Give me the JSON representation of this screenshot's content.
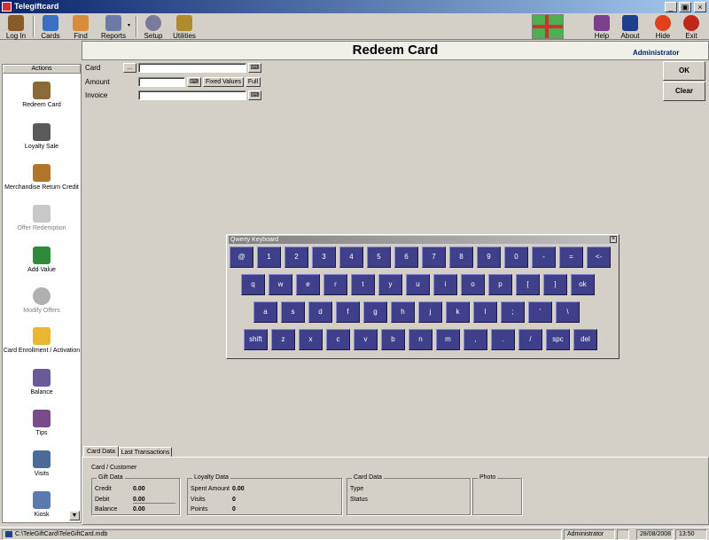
{
  "app": {
    "title": "Telegiftcard"
  },
  "window_buttons": {
    "minimize": "_",
    "restore": "▣",
    "close": "×"
  },
  "toolbar": {
    "login": "Log In",
    "cards": "Cards",
    "find": "Find",
    "reports": "Reports",
    "setup": "Setup",
    "utilities": "Utilities",
    "help": "Help",
    "about": "About",
    "hide": "Hide",
    "exit": "Exit"
  },
  "header": {
    "title": "Redeem Card",
    "user": "Administrator"
  },
  "sidebar": {
    "title": "Actions",
    "items": [
      {
        "label": "Redeem Card",
        "icon": "redeem-icon",
        "enabled": true
      },
      {
        "label": "Loyalty Sale",
        "icon": "loyalty-icon",
        "enabled": true
      },
      {
        "label": "Merchandise Return Credit",
        "icon": "return-icon",
        "enabled": true
      },
      {
        "label": "Offer Redemption",
        "icon": "offer-icon",
        "enabled": false
      },
      {
        "label": "Add Value",
        "icon": "add-value-icon",
        "enabled": true
      },
      {
        "label": "Modify Offers",
        "icon": "modify-offers-icon",
        "enabled": false
      },
      {
        "label": "Card Enrollment / Activation",
        "icon": "enrollment-icon",
        "enabled": true
      },
      {
        "label": "Balance",
        "icon": "balance-icon",
        "enabled": true
      },
      {
        "label": "Tips",
        "icon": "tips-icon",
        "enabled": true
      },
      {
        "label": "Visits",
        "icon": "visits-icon",
        "enabled": true
      },
      {
        "label": "Kiosk",
        "icon": "kiosk-icon",
        "enabled": true
      }
    ]
  },
  "form": {
    "card_label": "Card",
    "card_browse": "...",
    "card_value": "",
    "amount_label": "Amount",
    "amount_value": "",
    "fixed_values": "Fixed Values",
    "full": "Full",
    "invoice_label": "Invoice",
    "invoice_value": ""
  },
  "right_buttons": {
    "ok": "OK",
    "clear": "Clear"
  },
  "keyboard": {
    "title": "Qwerty Keyboard",
    "close": "×",
    "rows": [
      [
        "@",
        "1",
        "2",
        "3",
        "4",
        "5",
        "6",
        "7",
        "8",
        "9",
        "0",
        "-",
        "=",
        "<-"
      ],
      [
        "q",
        "w",
        "e",
        "r",
        "t",
        "y",
        "u",
        "i",
        "o",
        "p",
        "[",
        "]",
        "ok"
      ],
      [
        "a",
        "s",
        "d",
        "f",
        "g",
        "h",
        "j",
        "k",
        "l",
        ";",
        "'",
        "\\"
      ],
      [
        "shift",
        "z",
        "x",
        "c",
        "v",
        "b",
        "n",
        "m",
        ",",
        ".",
        "/",
        "spc",
        "del"
      ]
    ]
  },
  "tabs": {
    "card_data": "Card Data",
    "last_transactions": "Last Transactions"
  },
  "card_panel": {
    "section": "Card / Customer",
    "gift_data": {
      "title": "Gift Data",
      "credit_label": "Credit",
      "credit": "0.00",
      "debit_label": "Debit",
      "debit": "0.00",
      "balance_label": "Balance",
      "balance": "0.00"
    },
    "loyalty_data": {
      "title": "Loyalty Data",
      "spent_label": "Spent Amount",
      "spent": "0.00",
      "visits_label": "Visits",
      "visits": "0",
      "points_label": "Points",
      "points": "0"
    },
    "card_data": {
      "title": "Card Data",
      "type_label": "Type",
      "status_label": "Status"
    },
    "photo": {
      "title": "Photo"
    }
  },
  "statusbar": {
    "path": "C:\\TeleGiftCard\\TeleGiftCard.mdb",
    "user": "Administrator",
    "date": "28/08/2008",
    "time": "13:50"
  }
}
